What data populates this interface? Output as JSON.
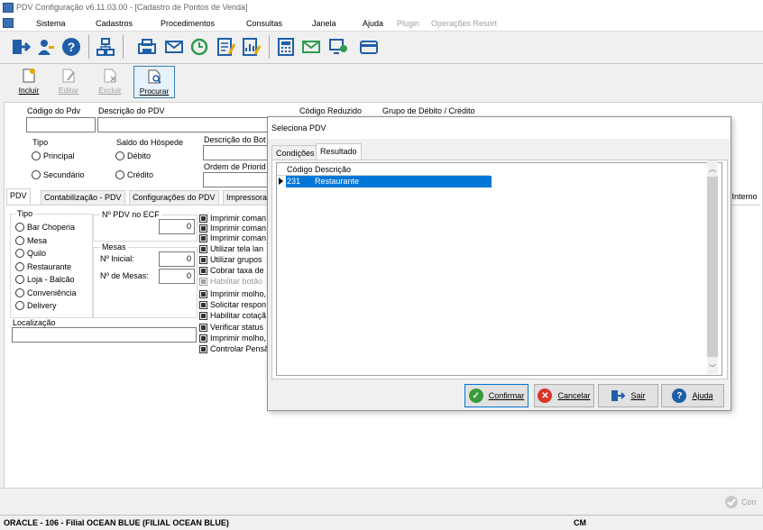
{
  "window": {
    "title": "PDV Configuração v6.11.03.00 - [Cadastro de Pontos de Venda]"
  },
  "menu": {
    "items": [
      "Sistema",
      "Cadastros",
      "Procedimentos",
      "Consultas",
      "Janela",
      "Ajuda"
    ],
    "disabled_items": [
      "Plugin",
      "Operações Resort"
    ]
  },
  "toolbar2": {
    "incluir": "Incluir",
    "editar": "Editar",
    "excluir": "Excluir",
    "procurar": "Procurar"
  },
  "form": {
    "codigo_pdv_label": "Código do Pdv",
    "descricao_pdv_label": "Descrição do PDV",
    "codigo_reduzido_label": "Código Reduzido",
    "grupo_debito_credito_label": "Grupo de Débito / Crédito",
    "tipo_label": "Tipo",
    "tipo_options": [
      "Principal",
      "Secundário"
    ],
    "saldo_label": "Saldo do Hóspede",
    "saldo_options": [
      "Débito",
      "Crédito"
    ],
    "descricao_bot_label": "Descrição do Bot",
    "ordem_prior_label": "Ordem de Priorid"
  },
  "tabs": [
    "PDV",
    "Contabilização - PDV",
    "Configurações do PDV",
    "Impressoras"
  ],
  "tab_right_partial": "o Interno",
  "pdv_tab": {
    "tipo_label": "Tipo",
    "tipo_options": [
      "Bar Choperia",
      "Mesa",
      "Quilo",
      "Restaurante",
      "Loja - Balcão",
      "Conveniência",
      "Delivery"
    ],
    "nr_pdv_ecf_label": "Nº PDV no ECF",
    "nr_pdv_ecf_value": "0",
    "mesas_label": "Mesas",
    "nr_inicial_label": "Nº Inicial:",
    "nr_inicial_value": "0",
    "nr_mesas_label": "Nº de Mesas:",
    "nr_mesas_value": "0",
    "localizacao_label": "Localização",
    "checkboxes": [
      {
        "label": "Imprimir coman",
        "disabled": false
      },
      {
        "label": "Imprimir coman",
        "disabled": false
      },
      {
        "label": "Imprimir coman",
        "disabled": false
      },
      {
        "label": "Utilizar tela lan",
        "disabled": false
      },
      {
        "label": "Utilizar grupos",
        "disabled": false
      },
      {
        "label": "Cobrar taxa de",
        "disabled": false
      },
      {
        "label": "Habilitar botão",
        "disabled": true
      },
      {
        "label": "Imprimir molho,",
        "disabled": false
      },
      {
        "label": "Solicitar respon",
        "disabled": false
      },
      {
        "label": "Habilitar cotaçã",
        "disabled": false
      },
      {
        "label": "Verificar status",
        "disabled": false
      },
      {
        "label": "Imprimir molho,",
        "disabled": false
      },
      {
        "label": "Controlar Pensã",
        "disabled": false
      }
    ]
  },
  "dialog": {
    "title": "Seleciona PDV",
    "tabs": [
      "Condições",
      "Resultado"
    ],
    "columns": [
      "Código",
      "Descrição"
    ],
    "rows": [
      {
        "codigo": "231",
        "descricao": "Restaurante"
      }
    ],
    "buttons": {
      "confirmar": "Confirmar",
      "cancelar": "Cancelar",
      "sair": "Sair",
      "ajuda": "Ajuda"
    }
  },
  "bottom": {
    "confirm_partial": "Con"
  },
  "status": {
    "left": "ORACLE - 106 - Filial OCEAN BLUE (FILIAL OCEAN BLUE)",
    "right": "CM"
  },
  "colors": {
    "selection": "#0078d7",
    "accent_blue": "#1f5fa8",
    "cancel_red": "#d9342b",
    "confirm_green": "#3a9a3a"
  }
}
